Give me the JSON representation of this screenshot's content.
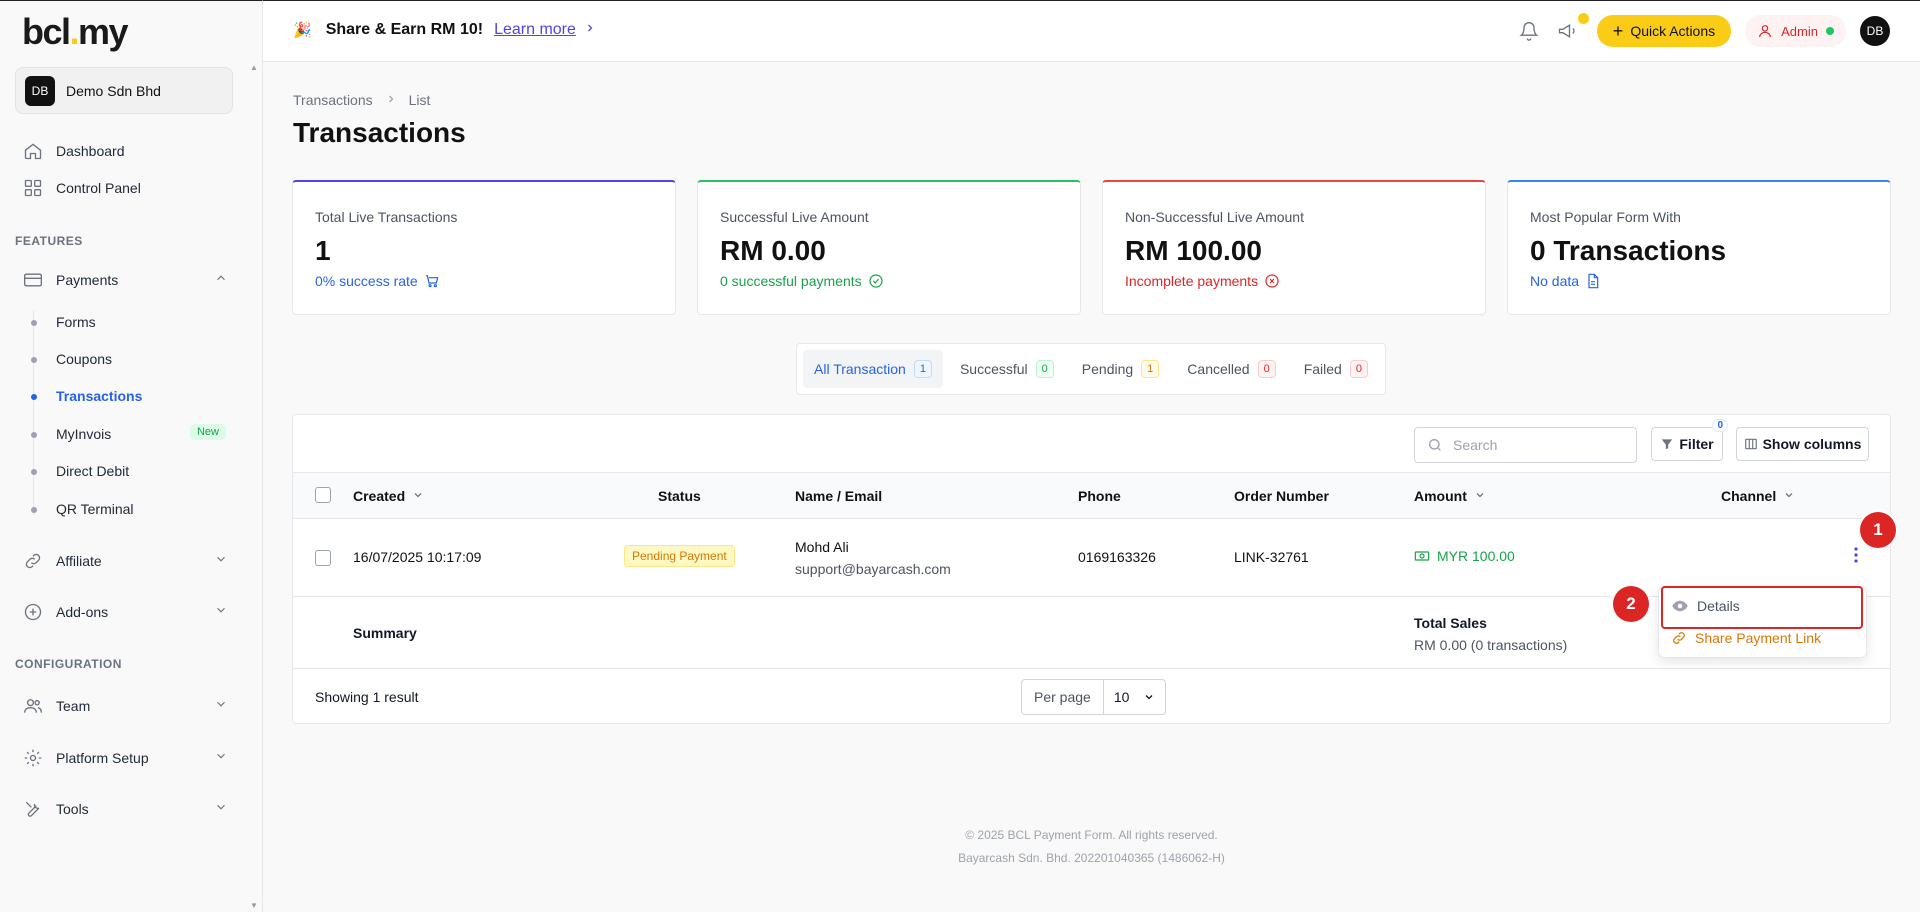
{
  "sidebar": {
    "logo_main": "bcl",
    "logo_dot": ".",
    "logo_tail": "my",
    "org": {
      "initials": "DB",
      "name": "Demo Sdn Bhd"
    },
    "nav_top": [
      {
        "label": "Dashboard",
        "icon": "home-icon"
      },
      {
        "label": "Control Panel",
        "icon": "grid-icon"
      }
    ],
    "features_label": "FEATURES",
    "payments_label": "Payments",
    "payments_sub": [
      {
        "label": "Forms"
      },
      {
        "label": "Coupons"
      },
      {
        "label": "Transactions"
      },
      {
        "label": "MyInvois",
        "badge": "New"
      },
      {
        "label": "Direct Debit"
      },
      {
        "label": "QR Terminal"
      }
    ],
    "affiliate_label": "Affiliate",
    "addons_label": "Add-ons",
    "config_label": "CONFIGURATION",
    "team_label": "Team",
    "platform_label": "Platform Setup",
    "tools_label": "Tools"
  },
  "header": {
    "promo_emoji": "🎉",
    "promo_text": "Share & Earn RM 10!",
    "learn_more": "Learn more",
    "quick_actions": "Quick Actions",
    "admin_label": "Admin",
    "avatar": "DB"
  },
  "breadcrumb": [
    "Transactions",
    "List"
  ],
  "page_title": "Transactions",
  "stats": [
    {
      "label": "Total Live Transactions",
      "value": "1",
      "sub": "0% success rate",
      "color": "#2563eb",
      "top": "#4f46e5"
    },
    {
      "label": "Successful Live Amount",
      "value": "RM 0.00",
      "sub": "0 successful payments",
      "color": "#16a34a",
      "top": "#22c55e"
    },
    {
      "label": "Non-Successful Live Amount",
      "value": "RM 100.00",
      "sub": "Incomplete payments",
      "color": "#dc2626",
      "top": "#ef4444"
    },
    {
      "label": "Most Popular Form With",
      "value": "0 Transactions",
      "sub": "No data",
      "color": "#2563eb",
      "top": "#3b82f6"
    }
  ],
  "tabs": [
    {
      "label": "All Transaction",
      "count": "1"
    },
    {
      "label": "Successful",
      "count": "0"
    },
    {
      "label": "Pending",
      "count": "1"
    },
    {
      "label": "Cancelled",
      "count": "0"
    },
    {
      "label": "Failed",
      "count": "0"
    }
  ],
  "toolbar": {
    "search_placeholder": "Search",
    "filter": "Filter",
    "filter_count": "0",
    "show_columns": "Show columns"
  },
  "table": {
    "headers": {
      "created": "Created",
      "status": "Status",
      "name": "Name / Email",
      "phone": "Phone",
      "order": "Order Number",
      "amount": "Amount",
      "channel": "Channel"
    },
    "rows": [
      {
        "created": "16/07/2025 10:17:09",
        "status": "Pending Payment",
        "name": "Mohd Ali",
        "email": "support@bayarcash.com",
        "phone": "0169163326",
        "order": "LINK-32761",
        "amount": "MYR 100.00"
      }
    ],
    "summary_label": "Summary",
    "total_sales_label": "Total Sales",
    "total_sales_value": "RM 0.00 (0 transactions)",
    "showing": "Showing 1 result",
    "per_page_label": "Per page",
    "per_page_value": "10"
  },
  "dropdown": {
    "details": "Details",
    "share": "Share Payment Link"
  },
  "markers": [
    "1",
    "2"
  ],
  "footer": {
    "line1": "© 2025 BCL Payment Form. All rights reserved.",
    "line2": "Bayarcash Sdn. Bhd. 202201040365 (1486062-H)"
  }
}
